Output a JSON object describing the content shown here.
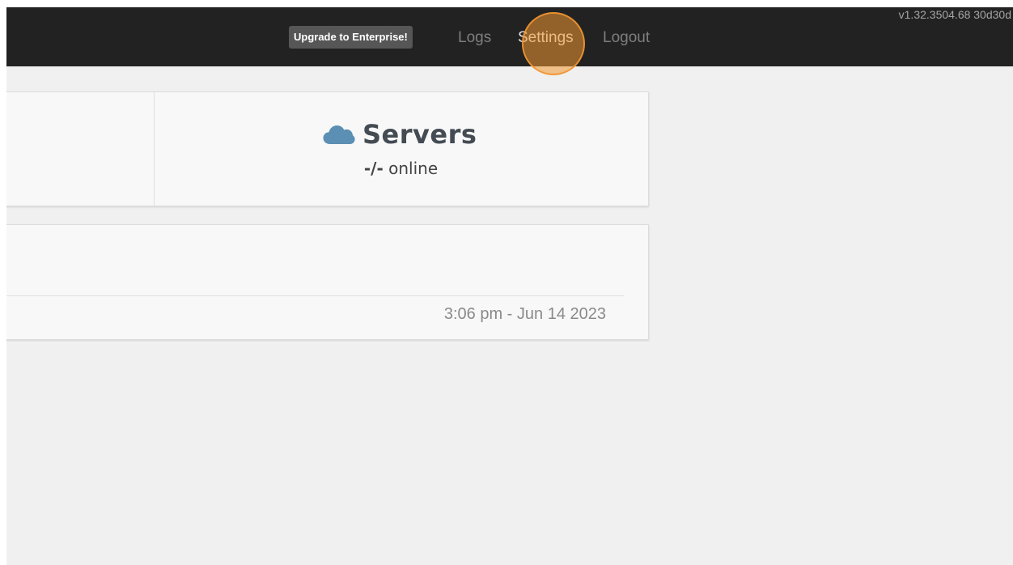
{
  "navbar": {
    "upgrade_label": "Upgrade to Enterprise!",
    "links": [
      "Logs",
      "Settings",
      "Logout"
    ],
    "version": "v1.32.3504.68 30d30d"
  },
  "servers": {
    "title": "Servers",
    "count": "-/-",
    "status": "online",
    "icon": "cloud-icon",
    "icon_color": "#5b8fb3"
  },
  "info": {
    "timestamp": "3:06 pm - Jun 14 2023"
  },
  "colors": {
    "navbar_bg": "#222222",
    "page_bg": "#f0f0f0",
    "click_highlight": "#f0963a"
  }
}
